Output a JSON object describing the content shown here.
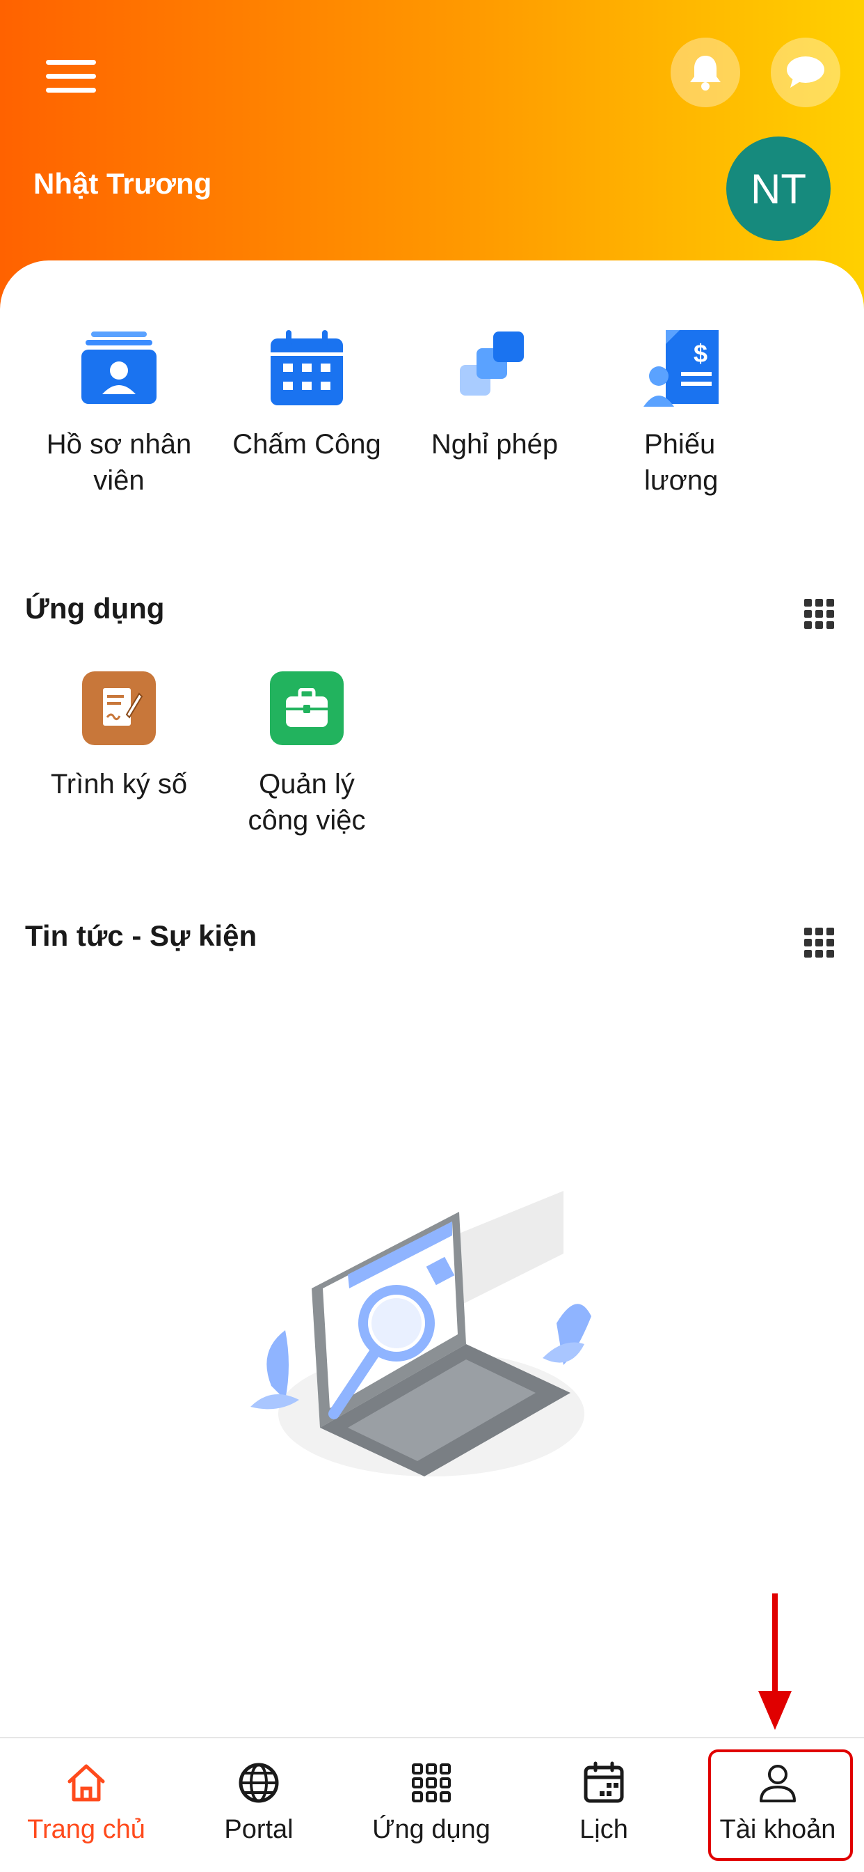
{
  "header": {
    "user_name": "Nhật Trương",
    "avatar_initials": "NT",
    "gradient": [
      "#ff6200",
      "#ffd000"
    ]
  },
  "quick_actions": [
    {
      "label": "Hồ sơ nhân viên",
      "icon": "employee-profile-icon"
    },
    {
      "label": "Chấm Công",
      "icon": "calendar-icon"
    },
    {
      "label": "Nghỉ phép",
      "icon": "leave-icon"
    },
    {
      "label": "Phiếu lương",
      "icon": "payslip-icon"
    }
  ],
  "apps_section": {
    "title": "Ứng dụng",
    "items": [
      {
        "label": "Trình ký số",
        "icon": "digital-sign-icon",
        "color": "#c8773a"
      },
      {
        "label": "Quản lý công việc",
        "icon": "briefcase-icon",
        "color": "#22b35e"
      }
    ]
  },
  "news_section": {
    "title": "Tin tức - Sự kiện"
  },
  "bottom_nav": [
    {
      "label": "Trang chủ",
      "icon": "home-icon",
      "active": true
    },
    {
      "label": "Portal",
      "icon": "globe-icon",
      "active": false
    },
    {
      "label": "Ứng dụng",
      "icon": "apps-grid-icon",
      "active": false
    },
    {
      "label": "Lịch",
      "icon": "calendar-icon",
      "active": false
    },
    {
      "label": "Tài khoản",
      "icon": "user-icon",
      "active": false
    }
  ],
  "colors": {
    "accent": "#ff4a1c",
    "icon_blue": "#1a73f0",
    "annotation_red": "#e00000"
  }
}
